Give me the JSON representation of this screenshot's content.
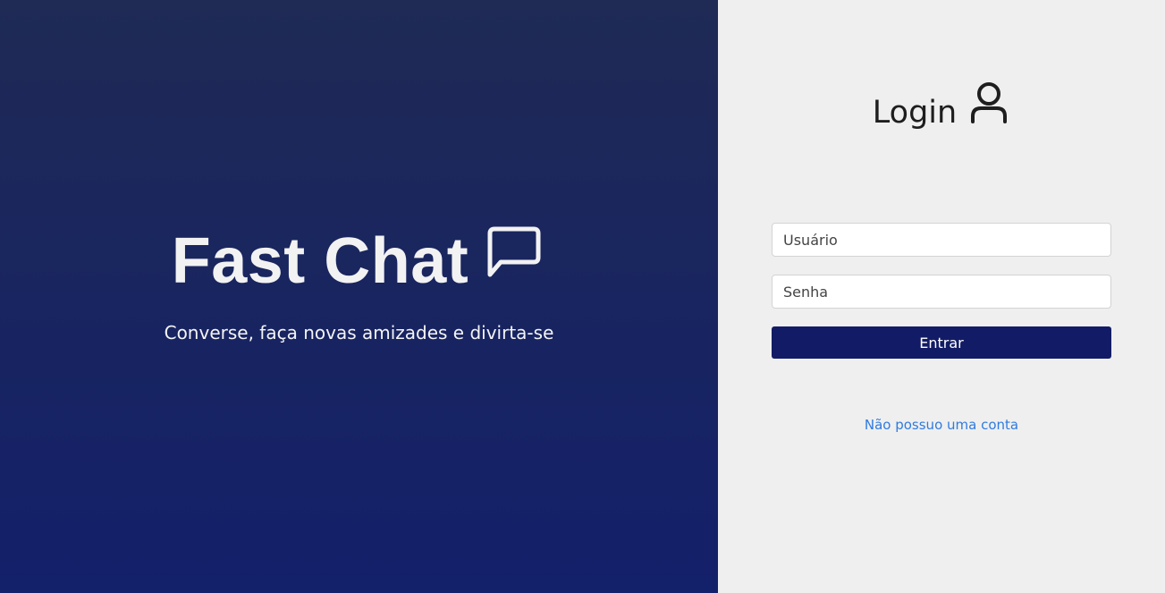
{
  "brand": {
    "title": "Fast Chat",
    "tagline": "Converse, faça novas amizades e divirta-se",
    "icon": "chat-bubble-icon"
  },
  "login": {
    "title": "Login",
    "icon": "user-icon",
    "username_placeholder": "Usuário",
    "password_placeholder": "Senha",
    "submit_label": "Entrar",
    "register_link": "Não possuo uma conta"
  },
  "colors": {
    "left_gradient_top": "#1f2a55",
    "left_gradient_bottom": "#13206a",
    "right_background": "#efefef",
    "button_background": "#121c66",
    "link_color": "#2f7be0"
  }
}
